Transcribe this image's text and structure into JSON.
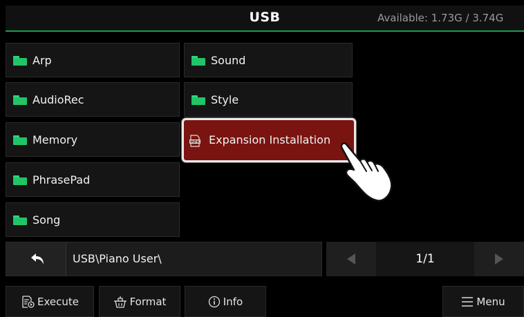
{
  "header": {
    "title": "USB",
    "available": "Available: 1.73G / 3.74G"
  },
  "folders": [
    {
      "label": "Arp"
    },
    {
      "label": "AudioRec"
    },
    {
      "label": "Memory"
    },
    {
      "label": "PhrasePad"
    },
    {
      "label": "Song"
    },
    {
      "label": "Sound"
    },
    {
      "label": "Style"
    }
  ],
  "selected_file": {
    "label": "Expansion Installation",
    "icon": "mpk-file-icon"
  },
  "path": {
    "text": "USB\\Piano User\\"
  },
  "pager": {
    "text": "1/1"
  },
  "toolbar": {
    "execute": "Execute",
    "format": "Format",
    "info": "Info",
    "menu": "Menu"
  },
  "colors": {
    "accent": "#1f9a53",
    "selected": "#7a1410",
    "folder": "#22c468"
  }
}
